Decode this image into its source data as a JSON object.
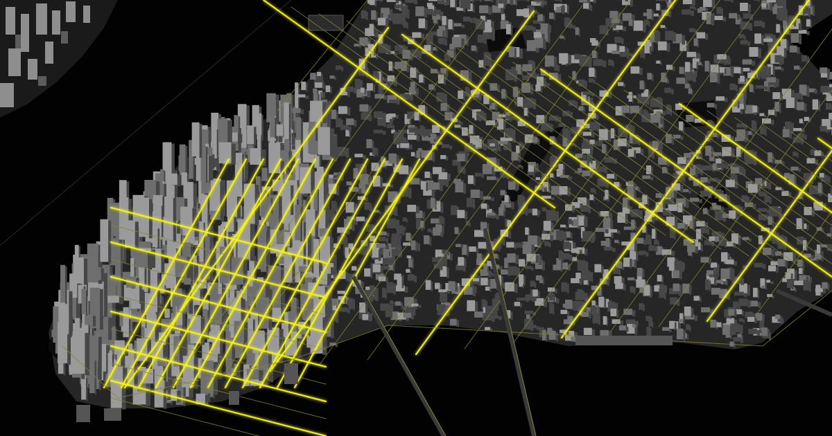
{
  "map": {
    "style": "3d-dark-city",
    "colors": {
      "background": "#000000",
      "water": "#020202",
      "land": "#262626",
      "building_light": "#9a9a9a",
      "building_mid": "#6e6e6e",
      "building_dark": "#474747",
      "street_glow": "#f4f21a",
      "street_dim": "#8a8630",
      "bridge": "#3a3a3a",
      "park": "#0d0d0d"
    },
    "labels": []
  }
}
